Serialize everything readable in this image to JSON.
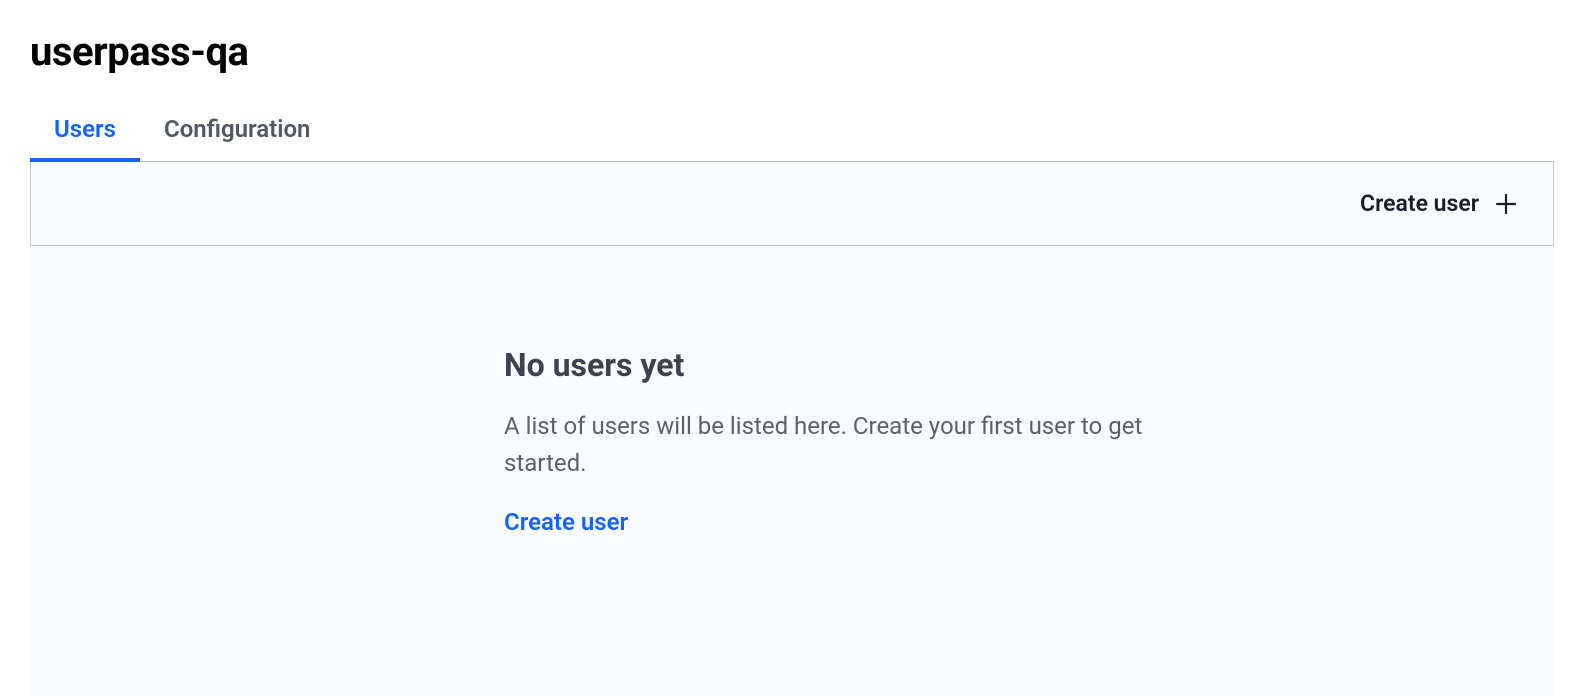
{
  "header": {
    "title": "userpass-qa"
  },
  "tabs": [
    {
      "label": "Users",
      "active": true
    },
    {
      "label": "Configuration",
      "active": false
    }
  ],
  "toolbar": {
    "create_user_label": "Create user"
  },
  "empty_state": {
    "heading": "No users yet",
    "description": "A list of users will be listed here. Create your first user to get started.",
    "link_label": "Create user"
  }
}
